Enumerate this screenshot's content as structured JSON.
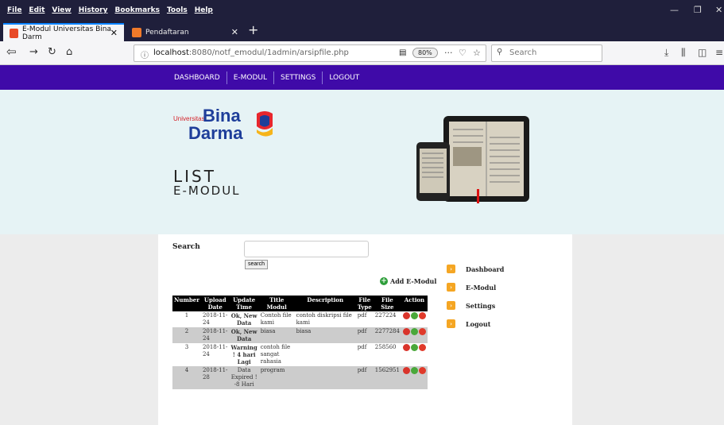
{
  "browser": {
    "menu": [
      "File",
      "Edit",
      "View",
      "History",
      "Bookmarks",
      "Tools",
      "Help"
    ],
    "tabs": [
      {
        "label": "E-Modul Universitas Bina Darm"
      },
      {
        "label": "Pendaftaran"
      }
    ],
    "url_host": "localhost",
    "url_path": ":8080/notf_emodul/1admin/arsipfile.php",
    "zoom": "80%",
    "search_placeholder": "Search"
  },
  "site": {
    "nav": [
      "DASHBOARD",
      "E-MODUL",
      "SETTINGS",
      "LOGOUT"
    ],
    "logo": {
      "small": "Universitas",
      "line1": "Bina",
      "line2": "Darma"
    },
    "title_line1": "LIST",
    "title_line2": "E-MODUL",
    "search_label": "Search",
    "search_button": "search",
    "add_label": "Add E-Modul",
    "table": {
      "headers": [
        "Number",
        "Upload Date",
        "Update Time",
        "Title Modul",
        "Description",
        "File Type",
        "File Size",
        "Action"
      ],
      "rows": [
        {
          "number": "1",
          "date": "2018-11-24",
          "status": "Ok, New Data",
          "status_color": "green",
          "title": "Contoh file kami",
          "description": "contoh diskripsi file kami",
          "type": "pdf",
          "size": "227224"
        },
        {
          "number": "2",
          "date": "2018-11-24",
          "status": "Ok, New Data",
          "status_color": "green",
          "title": "biasa",
          "description": "biasa",
          "type": "pdf",
          "size": "2277284"
        },
        {
          "number": "3",
          "date": "2018-11-24",
          "status": "Warning ! 4 hari Lagi",
          "status_color": "yellow",
          "title": "contoh file sangat rahasia",
          "description": "",
          "type": "pdf",
          "size": "258560"
        },
        {
          "number": "4",
          "date": "2018-11-28",
          "status": "Data Expired ! -8 Hari",
          "status_color": "red",
          "title": "program",
          "description": "",
          "type": "pdf",
          "size": "1562951"
        }
      ]
    },
    "sidebar": [
      "Dashboard",
      "E-Modul",
      "Settings",
      "Logout"
    ]
  },
  "colors": {
    "site_nav": "#3f0aa8",
    "hero_bg": "#e6f3f5",
    "browser_chrome": "#1f1f3b",
    "accent_orange": "#f5a623"
  }
}
